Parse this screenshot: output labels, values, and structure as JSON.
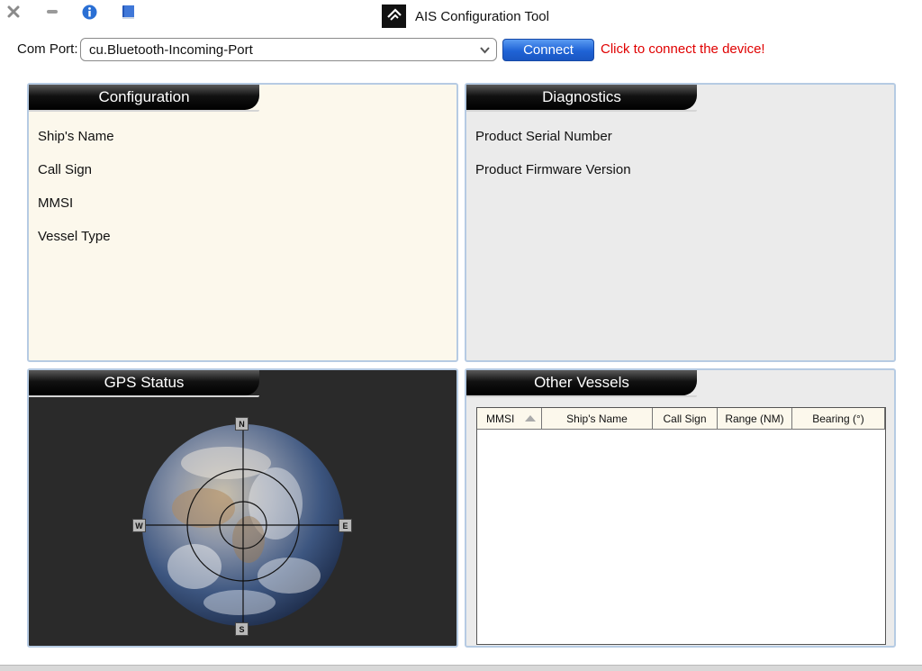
{
  "window": {
    "title": "AIS Configuration Tool",
    "icons": [
      "close-icon",
      "minimize-icon",
      "info-icon",
      "book-icon"
    ]
  },
  "comport": {
    "label": "Com Port:",
    "selected": "cu.Bluetooth-Incoming-Port",
    "connect_label": "Connect",
    "hint": "Click to connect the device!"
  },
  "configuration": {
    "title": "Configuration",
    "fields": [
      "Ship's Name",
      "Call Sign",
      "MMSI",
      "Vessel Type"
    ]
  },
  "diagnostics": {
    "title": "Diagnostics",
    "fields": [
      "Product Serial Number",
      "Product Firmware Version"
    ]
  },
  "gps": {
    "title": "GPS Status",
    "compass": {
      "n": "N",
      "s": "S",
      "e": "E",
      "w": "W"
    }
  },
  "vessels": {
    "title": "Other Vessels",
    "columns": [
      "MMSI",
      "Ship's Name",
      "Call Sign",
      "Range (NM)",
      "Bearing (°)"
    ],
    "rows": []
  },
  "colors": {
    "accent": "#1f63d6",
    "hint": "#e00000",
    "panel_border": "#b6cbe3",
    "config_bg": "#fcf8ec",
    "diag_bg": "#ebebeb",
    "gps_bg": "#2a2a2a"
  }
}
